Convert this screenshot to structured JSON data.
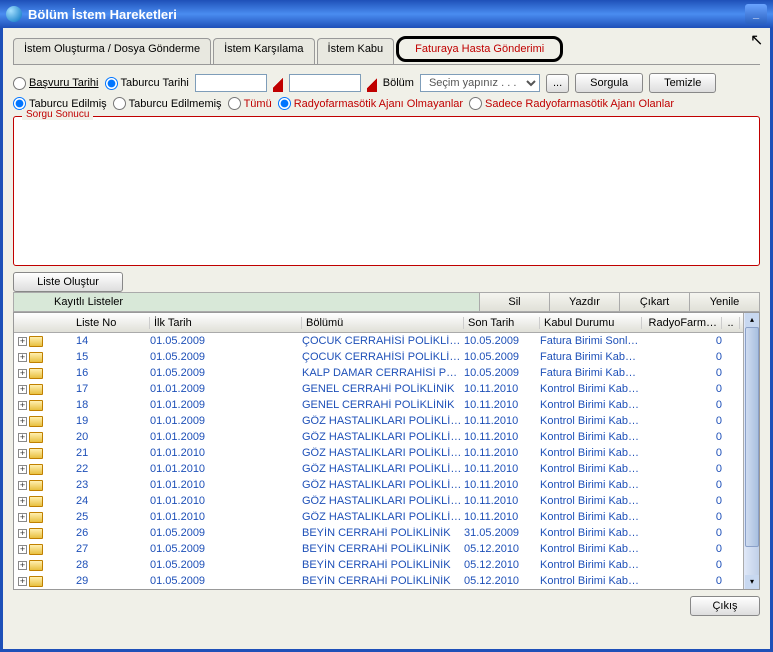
{
  "window": {
    "title": "Bölüm İstem Hareketleri"
  },
  "tabs": [
    "İstem Oluşturma / Dosya Gönderme",
    "İstem Karşılama",
    "İstem Kabu",
    "Faturaya Hasta Gönderimi"
  ],
  "filters": {
    "basvuru": "Başvuru Tarihi",
    "taburcu": "Taburcu Tarihi",
    "bolum_label": "Bölüm",
    "bolum_placeholder": "Seçim yapınız . . .",
    "sorgula": "Sorgula",
    "temizle": "Temizle",
    "edilmis": "Taburcu Edilmiş",
    "edilmemis": "Taburcu Edilmemiş",
    "tumu": "Tümü",
    "radyo_olmayan": "Radyofarmasötik Ajanı Olmayanlar",
    "radyo_olan": "Sadece Radyofarmasötik Ajanı Olanlar",
    "dots": "..."
  },
  "sorgu_legend": "Sorgu Sonucu",
  "liste_olustur": "Liste Oluştur",
  "kayitli": {
    "label": "Kayıtlı Listeler",
    "sil": "Sil",
    "yazdir": "Yazdır",
    "cikart": "Çıkart",
    "yenile": "Yenile"
  },
  "cols": {
    "listeno": "Liste No",
    "ilktarih": "İlk Tarih",
    "bolumu": "Bölümü",
    "sontarih": "Son Tarih",
    "kabul": "Kabul Durumu",
    "radyo": "RadyoFarm…",
    "dot": ".."
  },
  "rows": [
    {
      "no": "14",
      "ilk": "01.05.2009",
      "bol": "ÇOCUK CERRAHİSİ POLİKLİNİK",
      "son": "10.05.2009",
      "kabul": "Fatura Birimi Sonl…",
      "r": "0",
      "r2": "0"
    },
    {
      "no": "15",
      "ilk": "01.05.2009",
      "bol": "ÇOCUK CERRAHİSİ POLİKLİNİK",
      "son": "10.05.2009",
      "kabul": "Fatura Birimi Kabu…",
      "r": "0",
      "r2": "0"
    },
    {
      "no": "16",
      "ilk": "01.05.2009",
      "bol": "KALP DAMAR CERRAHİSİ POLİK…",
      "son": "10.05.2009",
      "kabul": "Fatura Birimi Kabu…",
      "r": "0",
      "r2": "0"
    },
    {
      "no": "17",
      "ilk": "01.01.2009",
      "bol": "GENEL CERRAHİ POLİKLİNİK",
      "son": "10.11.2010",
      "kabul": "Kontrol Birimi Kab…",
      "r": "0",
      "r2": "0"
    },
    {
      "no": "18",
      "ilk": "01.01.2009",
      "bol": "GENEL CERRAHİ POLİKLİNİK",
      "son": "10.11.2010",
      "kabul": "Kontrol Birimi Kab…",
      "r": "0",
      "r2": "0"
    },
    {
      "no": "19",
      "ilk": "01.01.2009",
      "bol": "GÖZ HASTALIKLARI POLİKLİNİK",
      "son": "10.11.2010",
      "kabul": "Kontrol Birimi Kab…",
      "r": "0",
      "r2": "0"
    },
    {
      "no": "20",
      "ilk": "01.01.2009",
      "bol": "GÖZ HASTALIKLARI POLİKLİNİK",
      "son": "10.11.2010",
      "kabul": "Kontrol Birimi Kab…",
      "r": "0",
      "r2": "0"
    },
    {
      "no": "21",
      "ilk": "01.01.2010",
      "bol": "GÖZ HASTALIKLARI POLİKLİNİK",
      "son": "10.11.2010",
      "kabul": "Kontrol Birimi Kab…",
      "r": "0",
      "r2": "0"
    },
    {
      "no": "22",
      "ilk": "01.01.2010",
      "bol": "GÖZ HASTALIKLARI POLİKLİNİK",
      "son": "10.11.2010",
      "kabul": "Kontrol Birimi Kab…",
      "r": "0",
      "r2": "0"
    },
    {
      "no": "23",
      "ilk": "01.01.2010",
      "bol": "GÖZ HASTALIKLARI POLİKLİNİK",
      "son": "10.11.2010",
      "kabul": "Kontrol Birimi Kab…",
      "r": "0",
      "r2": "0"
    },
    {
      "no": "24",
      "ilk": "01.01.2010",
      "bol": "GÖZ HASTALIKLARI POLİKLİNİK",
      "son": "10.11.2010",
      "kabul": "Kontrol Birimi Kab…",
      "r": "0",
      "r2": "0"
    },
    {
      "no": "25",
      "ilk": "01.01.2010",
      "bol": "GÖZ HASTALIKLARI POLİKLİNİK",
      "son": "10.11.2010",
      "kabul": "Kontrol Birimi Kab…",
      "r": "0",
      "r2": "0"
    },
    {
      "no": "26",
      "ilk": "01.05.2009",
      "bol": "BEYİN CERRAHİ POLİKLİNİK",
      "son": "31.05.2009",
      "kabul": "Kontrol Birimi Kab…",
      "r": "0",
      "r2": "0"
    },
    {
      "no": "27",
      "ilk": "01.05.2009",
      "bol": "BEYİN CERRAHİ POLİKLİNİK",
      "son": "05.12.2010",
      "kabul": "Kontrol Birimi Kab…",
      "r": "0",
      "r2": "0"
    },
    {
      "no": "28",
      "ilk": "01.05.2009",
      "bol": "BEYİN CERRAHİ POLİKLİNİK",
      "son": "05.12.2010",
      "kabul": "Kontrol Birimi Kab…",
      "r": "0",
      "r2": "0"
    },
    {
      "no": "29",
      "ilk": "01.05.2009",
      "bol": "BEYİN CERRAHİ POLİKLİNİK",
      "son": "05.12.2010",
      "kabul": "Kontrol Birimi Kab…",
      "r": "0",
      "r2": "0"
    }
  ],
  "cikis": "Çıkış"
}
